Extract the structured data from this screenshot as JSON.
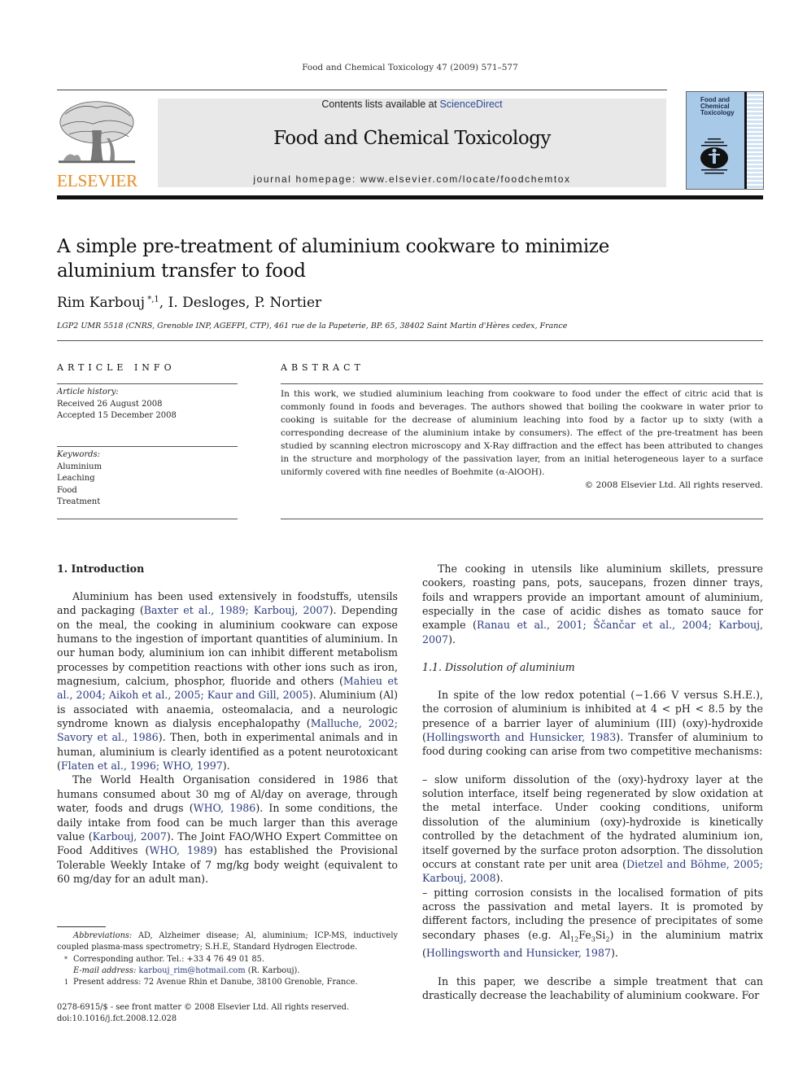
{
  "journal_citation": "Food and Chemical Toxicology 47 (2009) 571–577",
  "publisher_logo": {
    "icon": "elsevier-tree-icon",
    "text": "ELSEVIER",
    "color": "#f08a1c"
  },
  "banner": {
    "contents_prefix": "Contents lists available at ",
    "contents_link": "ScienceDirect",
    "journal_title": "Food and Chemical Toxicology",
    "homepage": "journal homepage: www.elsevier.com/locate/foodchemtox"
  },
  "cover": {
    "title_lines": [
      "Food and",
      "Chemical",
      "Toxicology"
    ],
    "icon": "journal-cover-figure-icon"
  },
  "article": {
    "title_line1": "A simple pre-treatment of aluminium cookware to minimize",
    "title_line2": "aluminium transfer to food",
    "author1": "Rim Karbouj",
    "author1_marks": "*,1",
    "other_authors": ", I. Desloges, P. Nortier",
    "affiliation": "LGP2 UMR 5518 (CNRS, Grenoble INP, AGEFPI, CTP), 461 rue de la Papeterie, BP. 65, 38402 Saint Martin d'Hères cedex, France"
  },
  "article_info": {
    "heading": "ARTICLE INFO",
    "history_label": "Article history:",
    "received": "Received 26 August 2008",
    "accepted": "Accepted 15 December 2008",
    "keywords_label": "Keywords:",
    "keywords": [
      "Aluminium",
      "Leaching",
      "Food",
      "Treatment"
    ]
  },
  "abstract": {
    "heading": "ABSTRACT",
    "text": "In this work, we studied aluminium leaching from cookware to food under the effect of citric acid that is commonly found in foods and beverages. The authors showed that boiling the cookware in water prior to cooking is suitable for the decrease of aluminium leaching into food by a factor up to sixty (with a corresponding decrease of the aluminium intake by consumers). The effect of the pre-treatment has been studied by scanning electron microscopy and X-Ray diffraction and the effect has been attributed to changes in the structure and morphology of the passivation layer, from an initial heterogeneous layer to a surface uniformly covered with fine needles of Boehmite (α-AlOOH).",
    "copyright": "© 2008 Elsevier Ltd. All rights reserved."
  },
  "intro": {
    "heading": "1. Introduction",
    "p1": [
      {
        "t": "Aluminium has been used extensively in foodstuffs, utensils and packaging ("
      },
      {
        "r": "Baxter et al., 1989; Karbouj, 2007"
      },
      {
        "t": "). Depending on the meal, the cooking in aluminium cookware can expose humans to the ingestion of important quantities of aluminium. In our human body, aluminium ion can inhibit different metabolism processes by competition reactions with other ions such as iron, magnesium, calcium, phosphor, fluoride and others ("
      },
      {
        "r": "Mahieu et al., 2004; Aikoh et al., 2005; Kaur and Gill, 2005"
      },
      {
        "t": "). Aluminium (Al) is associated with anaemia, osteomalacia, and a neurologic syndrome known as dialysis encephalopathy ("
      },
      {
        "r": "Malluche, 2002; Savory et al., 1986"
      },
      {
        "t": "). Then, both in experimental animals and in human, aluminium is clearly identified as a potent neurotoxicant ("
      },
      {
        "r": "Flaten et al., 1996; WHO, 1997"
      },
      {
        "t": ")."
      }
    ],
    "p2": [
      {
        "t": "The World Health Organisation considered in 1986 that humans consumed about 30 mg of Al/day on average, through water, foods and drugs ("
      },
      {
        "r": "WHO, 1986"
      },
      {
        "t": "). In some conditions, the daily intake from food can be much larger than this average value ("
      },
      {
        "r": "Karbouj, 2007"
      },
      {
        "t": "). The Joint FAO/WHO Expert Committee on Food Additives ("
      },
      {
        "r": "WHO, 1989"
      },
      {
        "t": ") has established the Provisional Tolerable Weekly Intake of 7 mg/kg body weight (equivalent to 60 mg/day for an adult man)."
      }
    ],
    "p3": [
      {
        "t": "The cooking in utensils like aluminium skillets, pressure cookers, roasting pans, pots, saucepans, frozen dinner trays, foils and wrappers provide an important amount of aluminium, especially in the case of acidic dishes as tomato sauce for example ("
      },
      {
        "r": "Ranau et al., 2001; Ščančar et al., 2004; Karbouj, 2007"
      },
      {
        "t": ")."
      }
    ],
    "subheading": "1.1. Dissolution of aluminium",
    "p4": [
      {
        "t": "In spite of the low redox potential (−1.66 V versus S.H.E.), the corrosion of aluminium is inhibited at 4 < pH < 8.5 by the presence of a barrier layer of aluminium (III) (oxy)-hydroxide ("
      },
      {
        "r": "Hollingsworth and Hunsicker, 1983"
      },
      {
        "t": "). Transfer of aluminium to food during cooking can arise from two competitive mechanisms:"
      }
    ],
    "bullet1": [
      {
        "t": "–  slow uniform dissolution of the (oxy)-hydroxy layer at the solution interface, itself being regenerated by slow oxidation at the metal interface. Under cooking conditions, uniform dissolution of the aluminium (oxy)-hydroxide is kinetically controlled by the detachment of the hydrated aluminium ion, itself governed by the surface proton adsorption. The dissolution occurs at constant rate per unit area ("
      },
      {
        "r": "Dietzel and Böhme, 2005; Karbouj, 2008"
      },
      {
        "t": ")."
      }
    ],
    "bullet2": [
      {
        "t": "–  pitting corrosion consists in the localised formation of pits across the passivation and metal layers. It is promoted by different factors, including the presence of precipitates of some secondary phases (e.g. Al"
      },
      {
        "sub": "12"
      },
      {
        "t": "Fe"
      },
      {
        "sub": "3"
      },
      {
        "t": "Si"
      },
      {
        "sub": "2"
      },
      {
        "t": ") in the aluminium matrix ("
      },
      {
        "r": "Hollingsworth and Hunsicker, 1987"
      },
      {
        "t": ")."
      }
    ],
    "p5": [
      {
        "t": "In this paper, we describe a simple treatment that can drastically decrease the leachability of aluminium cookware. For"
      }
    ]
  },
  "footnotes": {
    "abbrev_label": "Abbreviations:",
    "abbrev_text": " AD, Alzheimer disease; Al, aluminium; ICP-MS, inductively coupled plasma-mass spectrometry; S.H.E, Standard Hydrogen Electrode.",
    "corr_mark": "*",
    "corr_text": "Corresponding author. Tel.: +33 4 76 49 01 85.",
    "email_label": "E-mail address:",
    "email": "karbouj_rim@hotmail.com",
    "email_suffix": " (R. Karbouj).",
    "present_mark": "1",
    "present_text": "Present address: 72 Avenue Rhin et Danube, 38100 Grenoble, France."
  },
  "front_matter": {
    "issn_line": "0278-6915/$ - see front matter © 2008 Elsevier Ltd. All rights reserved.",
    "doi": "doi:10.1016/j.fct.2008.12.028"
  },
  "colors": {
    "link": "#2a3b8f",
    "elsevier_orange": "#f08a1c",
    "banner_bg": "#e8e8e8"
  }
}
